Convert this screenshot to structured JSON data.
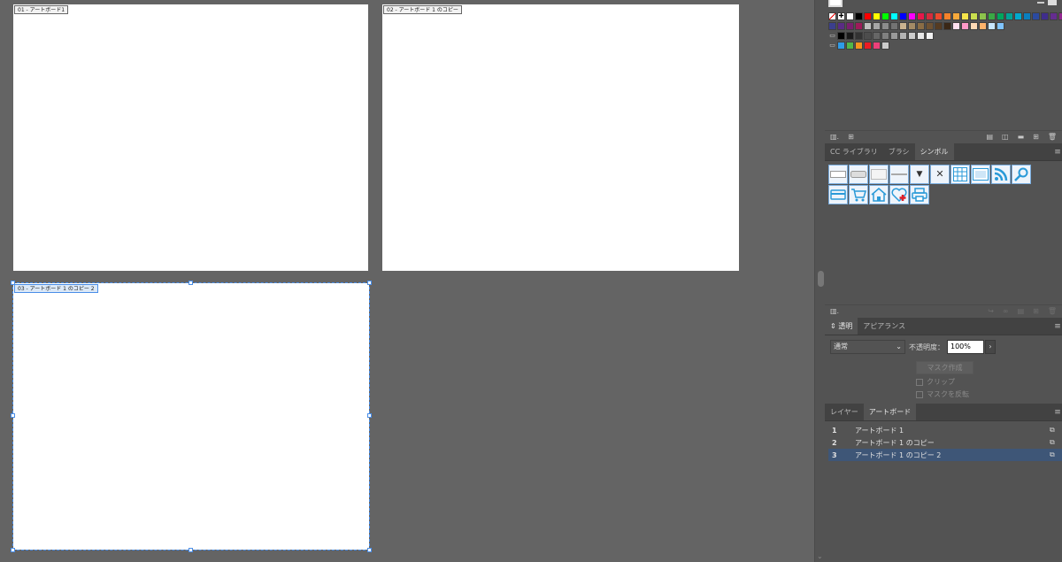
{
  "canvas": {
    "artboards": [
      {
        "label": "01 - アートボード1",
        "selected": false
      },
      {
        "label": "02 - アートボード 1 のコピー",
        "selected": false
      },
      {
        "label": "03 - アートボード 1 のコピー 2",
        "selected": true
      }
    ]
  },
  "swatches_panel": {
    "rows": [
      [
        "#ffffff",
        "#000000",
        "#ff0000",
        "#ffff00",
        "#00ff00",
        "#00ffff",
        "#0000ff",
        "#ff00ff",
        "#e6194b",
        "#d62c3c",
        "#ed4a2d",
        "#f5822a",
        "#f7a93b",
        "#f5e44a",
        "#c9df4e",
        "#8cc44c",
        "#3aa845",
        "#00a65d",
        "#00a396",
        "#00a9cf",
        "#0a7fbf",
        "#2b4aa0",
        "#3f2d8c",
        "#652d90",
        "#92278f",
        "#c1258d"
      ],
      [
        "#3b3f8c",
        "#5a2c84",
        "#7a1f6e",
        "#9e1b5a",
        "#bfbfbf",
        "#a6a6a6",
        "#8c8c8c",
        "#737373",
        "#c9b38f",
        "#a38b65",
        "#8a6d45",
        "#6e5233",
        "#553b22",
        "#3a2716",
        "#ffe0f0",
        "#ff99c8",
        "#ffd9b3",
        "#ffb36b",
        "#c8e6ff",
        "#80c4ff"
      ],
      [
        "#000000",
        "#1a1a1a",
        "#333333",
        "#4d4d4d",
        "#666666",
        "#808080",
        "#999999",
        "#b3b3b3",
        "#cccccc",
        "#e6e6e6",
        "#f2f2f2"
      ],
      [
        "#2e9be8",
        "#51b848",
        "#f7941d",
        "#ec1c24",
        "#ec407a",
        "#cccccc"
      ]
    ]
  },
  "symbols_panel": {
    "tabs": [
      "CC ライブラリ",
      "ブラシ",
      "シンボル"
    ],
    "active_tab": "シンボル",
    "symbols": [
      "text-field-icon",
      "button-icon",
      "blank-button-icon",
      "slider-icon",
      "dropdown-icon",
      "close-x-icon",
      "calendar-grid-icon",
      "film-strip-icon",
      "rss-icon",
      "magnifier-icon",
      "card-icon",
      "cart-icon",
      "home-icon",
      "heart-plus-icon",
      "printer-icon"
    ]
  },
  "transparency_panel": {
    "tabs": [
      "透明",
      "アピアランス"
    ],
    "active_tab": "透明",
    "blend_mode": "通常",
    "opacity_label": "不透明度：",
    "opacity_value": "100%",
    "mask_button": "マスク作成",
    "clip_label": "クリップ",
    "invert_mask_label": "マスクを反転"
  },
  "artboards_panel": {
    "tabs": [
      "レイヤー",
      "アートボード"
    ],
    "active_tab": "アートボード",
    "rows": [
      {
        "num": "1",
        "name": "アートボード 1",
        "selected": false
      },
      {
        "num": "2",
        "name": "アートボード 1 のコピー",
        "selected": false
      },
      {
        "num": "3",
        "name": "アートボード 1 のコピー 2",
        "selected": true
      }
    ]
  }
}
